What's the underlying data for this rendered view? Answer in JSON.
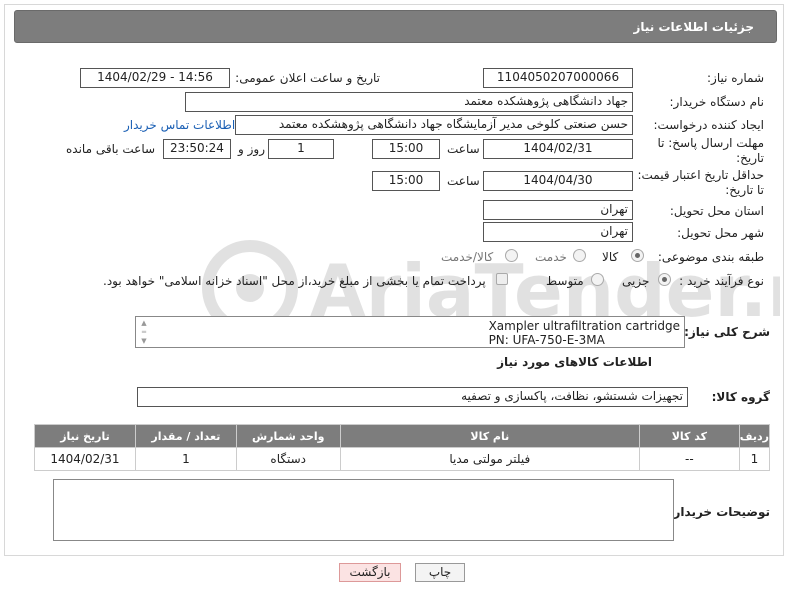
{
  "header": {
    "title": "جزئیات اطلاعات نیاز"
  },
  "fields": {
    "need_number": {
      "label": "شماره نیاز:",
      "value": "1104050207000066"
    },
    "announce": {
      "label": "تاریخ و ساعت اعلان عمومی:",
      "value": "1404/02/29 - 14:56"
    },
    "buyer_org": {
      "label": "نام دستگاه خریدار:",
      "value": "جهاد دانشگاهی پژوهشکده معتمد"
    },
    "requester": {
      "label": "ایجاد کننده درخواست:",
      "value": "حسن صنعتی کلوخی مدیر آزمایشگاه جهاد دانشگاهی پژوهشکده معتمد",
      "link": "اطلاعات تماس خریدار"
    },
    "deadline": {
      "label": "مهلت ارسال پاسخ: تا تاریخ:",
      "date": "1404/02/31",
      "time_label": "ساعت",
      "time": "15:00",
      "days": "1",
      "days_label": "روز و",
      "remaining": "23:50:24",
      "remaining_label": "ساعت باقی مانده"
    },
    "validity": {
      "label": "حداقل تاریخ اعتبار قیمت: تا تاریخ:",
      "date": "1404/04/30",
      "time_label": "ساعت",
      "time": "15:00"
    },
    "province": {
      "label": "استان محل تحویل:",
      "value": "تهران"
    },
    "city": {
      "label": "شهر محل تحویل:",
      "value": "تهران"
    },
    "category": {
      "label": "طبقه بندی موضوعی:",
      "options": [
        "کالا",
        "خدمت",
        "کالا/خدمت"
      ],
      "selected": "کالا"
    },
    "process": {
      "label": "نوع فرآیند خرید :",
      "options": [
        "جزیی",
        "متوسط"
      ],
      "selected": "جزیی",
      "note": "پرداخت تمام یا بخشی از مبلغ خرید،از محل \"اسناد خزانه اسلامی\" خواهد بود."
    }
  },
  "description": {
    "label": "شرح کلی نیاز:",
    "line1": "Xampler ultrafiltration cartridge",
    "line2": "PN: UFA-750-E-3MA"
  },
  "goods_section": {
    "title": "اطلاعات کالاهای مورد نیاز"
  },
  "goods_group": {
    "label": "گروه کالا:",
    "value": "تجهیزات شستشو، نظافت، پاکسازی و تصفیه"
  },
  "table": {
    "headers": [
      "ردیف",
      "کد کالا",
      "نام کالا",
      "واحد شمارش",
      "تعداد / مقدار",
      "تاریخ نیاز"
    ],
    "rows": [
      {
        "row": "1",
        "code": "--",
        "name": "فیلتر مولتی مدیا",
        "unit": "دستگاه",
        "qty": "1",
        "date": "1404/02/31"
      }
    ]
  },
  "notes": {
    "label": "توضیحات خریدار:"
  },
  "buttons": {
    "print": "چاپ",
    "back": "بازگشت"
  },
  "watermark": {
    "text": "AriaTender.neT"
  }
}
